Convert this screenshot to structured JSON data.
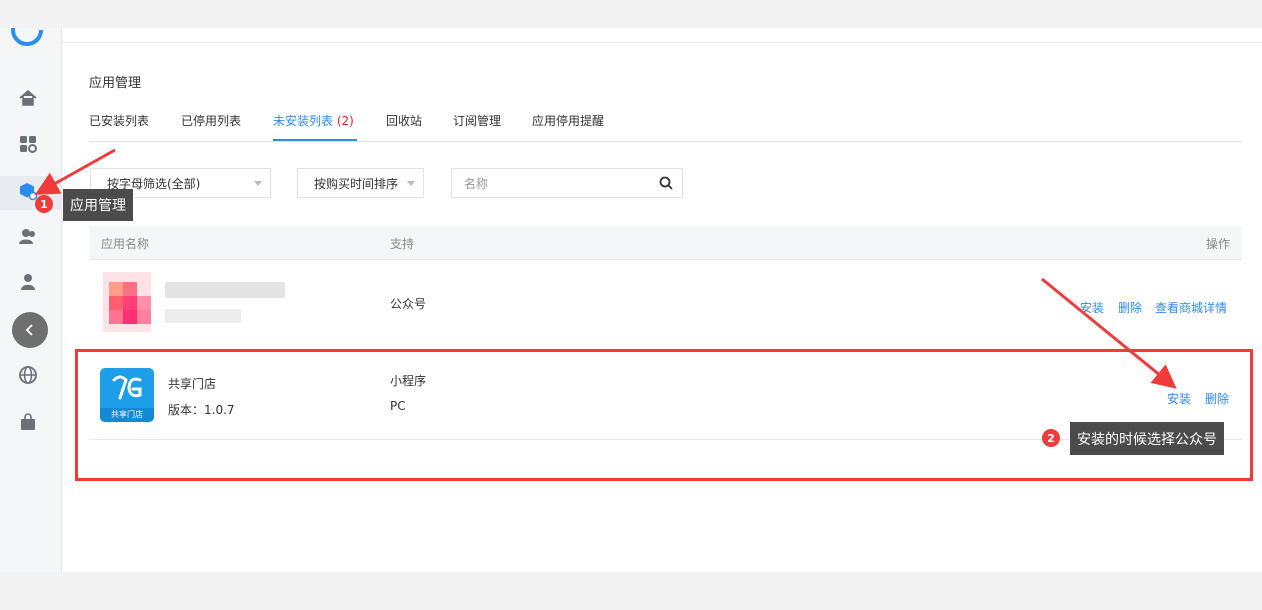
{
  "app": {
    "brand_color": "#2d8cf0",
    "danger_color": "#e0282a",
    "annotation_color": "#f03b3b"
  },
  "sidebar": {
    "items": [
      {
        "name": "home-icon",
        "glyph": "⌂"
      },
      {
        "name": "apps-settings-icon",
        "glyph": "▦"
      },
      {
        "name": "app-management-icon",
        "glyph": "⬢",
        "active": true
      },
      {
        "name": "users-icon",
        "glyph": "👥"
      },
      {
        "name": "user-lock-icon",
        "glyph": "👤"
      },
      {
        "name": "monitor-icon",
        "glyph": "🖥"
      },
      {
        "name": "globe-icon",
        "glyph": "🌐"
      },
      {
        "name": "shopping-bag-icon",
        "glyph": "👜"
      }
    ],
    "collapse_icon": "chevron-left-icon"
  },
  "page": {
    "title": "应用管理"
  },
  "tabs": [
    {
      "label": "已安装列表"
    },
    {
      "label": "已停用列表"
    },
    {
      "label": "未安装列表",
      "count": "(2)",
      "active": true
    },
    {
      "label": "回收站"
    },
    {
      "label": "订阅管理"
    },
    {
      "label": "应用停用提醒"
    }
  ],
  "filters": {
    "letter_filter": "按字母筛选(全部)",
    "sort": "按购买时间排序",
    "search_placeholder": "名称"
  },
  "table": {
    "headers": {
      "name": "应用名称",
      "support": "支持",
      "actions": "操作"
    },
    "rows": [
      {
        "name": "",
        "support": [
          "公众号"
        ],
        "actions": [
          "安装",
          "删除",
          "查看商城详情"
        ]
      },
      {
        "name": "共享门店",
        "version": "版本：1.0.7",
        "icon_label": "共享门店",
        "support": [
          "小程序",
          "PC"
        ],
        "actions": [
          "安装",
          "删除"
        ]
      }
    ]
  },
  "annotations": {
    "tip1": {
      "number": "1",
      "text": "应用管理"
    },
    "tip2": {
      "number": "2",
      "text": "安装的时候选择公众号"
    }
  }
}
